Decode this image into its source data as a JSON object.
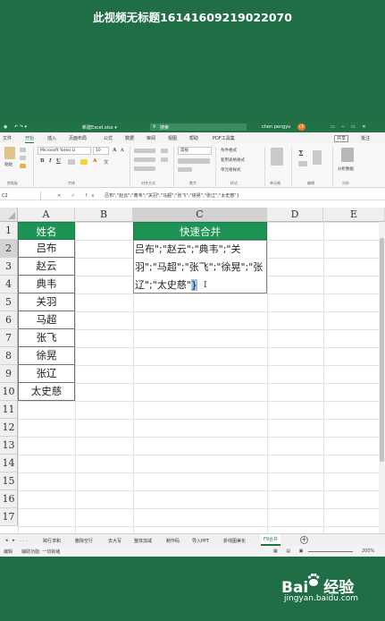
{
  "video_title": "此视频无标题16141609219022070",
  "titlebar": {
    "quick_access": "↶ ↷ ▾",
    "filename": "新建Excel.xlsx ▾",
    "search_placeholder": "搜索",
    "user": "chen pengyu",
    "avatar_initials": "CP",
    "window_controls": "▭ ─ ▭ ✕"
  },
  "menu": {
    "items": [
      "文件",
      "开始",
      "插入",
      "页面布局",
      "公式",
      "数据",
      "审阅",
      "视图",
      "帮助",
      "PDF工具集"
    ],
    "active": "开始",
    "share": "共享",
    "comment": "批注"
  },
  "ribbon": {
    "paste": "粘贴",
    "clipboard": "剪贴板",
    "font_name": "Microsoft YaHei Li",
    "font_size": "10",
    "font_group": "字体",
    "align_group": "对齐方式",
    "number_format": "常规",
    "number_group": "数字",
    "cond_format": "条件格式",
    "table_format": "套用表格格式",
    "cell_styles": "单元格样式",
    "styles_group": "样式",
    "cells": "单元格",
    "cells_group": "单元格",
    "editing_group": "编辑",
    "analysis": "分析数据",
    "analysis_group": "分析"
  },
  "formula_bar": {
    "name_box": "C2",
    "icons": "✕ ✓ fx",
    "formula": "吕布\";\"赵云\";\"典韦\";\"关羽\";\"马超\";\"张飞\";\"徐晃\";\"张辽\";\"太史慈\"}"
  },
  "columns": [
    "A",
    "B",
    "C",
    "D",
    "E"
  ],
  "rows": [
    "1",
    "2",
    "3",
    "4",
    "5",
    "6",
    "7",
    "8",
    "9",
    "10",
    "11",
    "12",
    "13",
    "14",
    "15",
    "16",
    "17"
  ],
  "table_a": {
    "header": "姓名",
    "names": [
      "吕布",
      "赵云",
      "典韦",
      "关羽",
      "马超",
      "张飞",
      "徐晃",
      "张辽",
      "太史慈"
    ]
  },
  "table_c": {
    "header": "快速合并",
    "edit_text": "吕布\";\"赵云\";\"典韦\";\"关羽\";\"马超\";\"张飞\";\"徐晃\";\"张辽\";\"太史慈\"",
    "selected_char": "}"
  },
  "sheet_tabs": {
    "nav": "◂ ▸ ...",
    "tabs": [
      "跨行求和",
      "删除空行",
      "去大写",
      "整体加减",
      "制作码",
      "导入PPT",
      "折线图美化",
      "F9合并"
    ],
    "active": "F9合并",
    "add": "+"
  },
  "status": {
    "mode": "编辑",
    "accessibility": "辅助功能: 一切就绪",
    "zoom": "200%"
  },
  "watermark": {
    "brand_left": "Bai",
    "brand_right": "经验",
    "url": "jingyan.baidu.com"
  },
  "colors": {
    "excel_green": "#217346",
    "header_fill": "#1e9356",
    "background": "#1f6e45",
    "selection": "#9ec4ea"
  }
}
